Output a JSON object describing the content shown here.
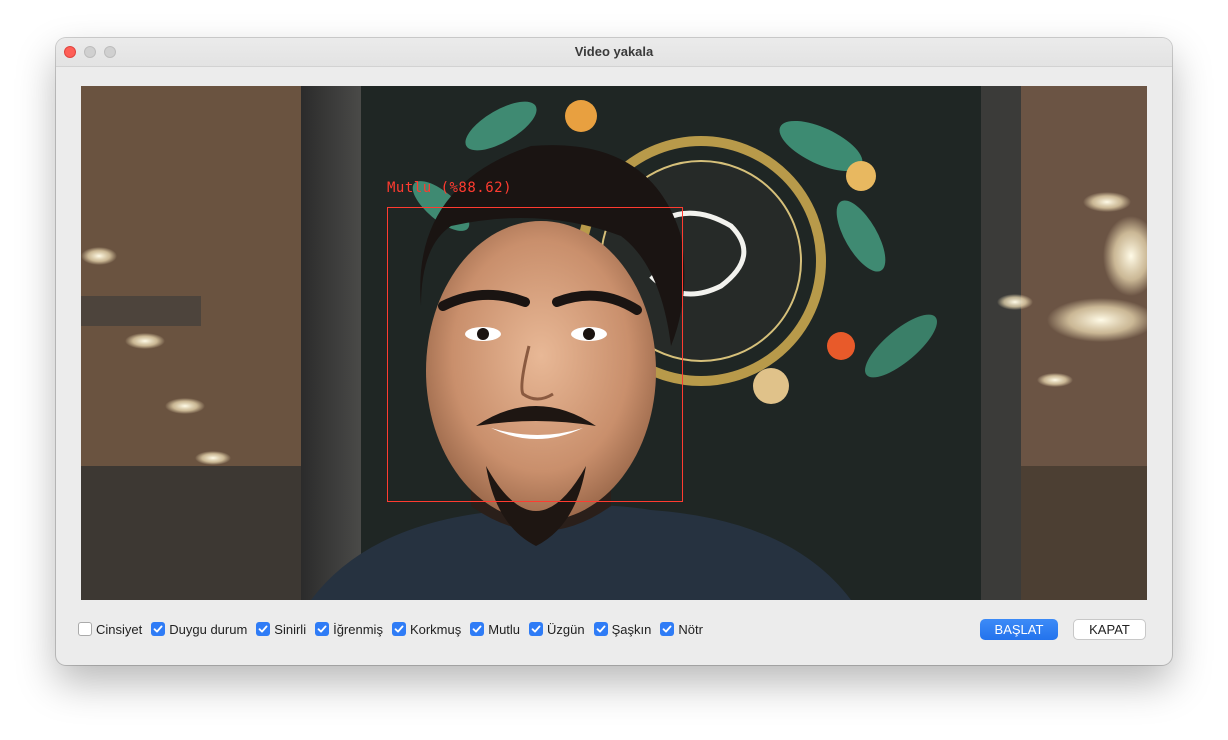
{
  "window": {
    "title": "Video yakala"
  },
  "video": {
    "detection_label": "Mutlu (%88.62)",
    "box_color": "#ff3b30"
  },
  "checkboxes": [
    {
      "label": "Cinsiyet",
      "checked": false
    },
    {
      "label": "Duygu durum",
      "checked": true
    },
    {
      "label": "Sinirli",
      "checked": true
    },
    {
      "label": "İğrenmiş",
      "checked": true
    },
    {
      "label": "Korkmuş",
      "checked": true
    },
    {
      "label": "Mutlu",
      "checked": true
    },
    {
      "label": "Üzgün",
      "checked": true
    },
    {
      "label": "Şaşkın",
      "checked": true
    },
    {
      "label": "Nötr",
      "checked": true
    }
  ],
  "buttons": {
    "start_label": "BAŞLAT",
    "close_label": "KAPAT"
  },
  "colors": {
    "accent": "#2f7cf6",
    "close_light": "#fe5f57"
  }
}
